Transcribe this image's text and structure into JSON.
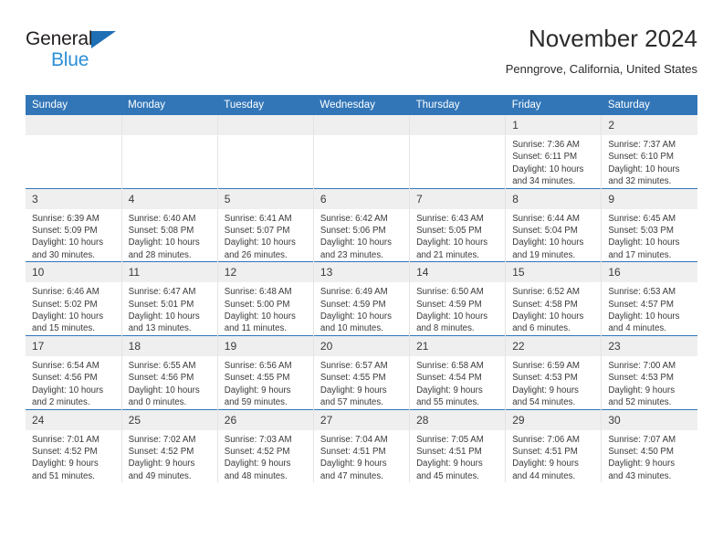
{
  "brand": {
    "name_part1": "General",
    "name_part2": "Blue",
    "triangle_color": "#1f6fb5",
    "blue_text_color": "#2b8fd6"
  },
  "header": {
    "title": "November 2024",
    "subtitle": "Penngrove, California, United States"
  },
  "theme": {
    "header_row_bg": "#3276b8",
    "daynum_bg": "#efefef",
    "row_divider": "#3276b8",
    "cell_divider": "#e4e4e4",
    "text": "#3a3a3a"
  },
  "columns": [
    "Sunday",
    "Monday",
    "Tuesday",
    "Wednesday",
    "Thursday",
    "Friday",
    "Saturday"
  ],
  "weeks": [
    [
      {
        "day": "",
        "empty": true
      },
      {
        "day": "",
        "empty": true
      },
      {
        "day": "",
        "empty": true
      },
      {
        "day": "",
        "empty": true
      },
      {
        "day": "",
        "empty": true
      },
      {
        "day": "1",
        "sunrise": "Sunrise: 7:36 AM",
        "sunset": "Sunset: 6:11 PM",
        "daylight1": "Daylight: 10 hours",
        "daylight2": "and 34 minutes."
      },
      {
        "day": "2",
        "sunrise": "Sunrise: 7:37 AM",
        "sunset": "Sunset: 6:10 PM",
        "daylight1": "Daylight: 10 hours",
        "daylight2": "and 32 minutes."
      }
    ],
    [
      {
        "day": "3",
        "sunrise": "Sunrise: 6:39 AM",
        "sunset": "Sunset: 5:09 PM",
        "daylight1": "Daylight: 10 hours",
        "daylight2": "and 30 minutes."
      },
      {
        "day": "4",
        "sunrise": "Sunrise: 6:40 AM",
        "sunset": "Sunset: 5:08 PM",
        "daylight1": "Daylight: 10 hours",
        "daylight2": "and 28 minutes."
      },
      {
        "day": "5",
        "sunrise": "Sunrise: 6:41 AM",
        "sunset": "Sunset: 5:07 PM",
        "daylight1": "Daylight: 10 hours",
        "daylight2": "and 26 minutes."
      },
      {
        "day": "6",
        "sunrise": "Sunrise: 6:42 AM",
        "sunset": "Sunset: 5:06 PM",
        "daylight1": "Daylight: 10 hours",
        "daylight2": "and 23 minutes."
      },
      {
        "day": "7",
        "sunrise": "Sunrise: 6:43 AM",
        "sunset": "Sunset: 5:05 PM",
        "daylight1": "Daylight: 10 hours",
        "daylight2": "and 21 minutes."
      },
      {
        "day": "8",
        "sunrise": "Sunrise: 6:44 AM",
        "sunset": "Sunset: 5:04 PM",
        "daylight1": "Daylight: 10 hours",
        "daylight2": "and 19 minutes."
      },
      {
        "day": "9",
        "sunrise": "Sunrise: 6:45 AM",
        "sunset": "Sunset: 5:03 PM",
        "daylight1": "Daylight: 10 hours",
        "daylight2": "and 17 minutes."
      }
    ],
    [
      {
        "day": "10",
        "sunrise": "Sunrise: 6:46 AM",
        "sunset": "Sunset: 5:02 PM",
        "daylight1": "Daylight: 10 hours",
        "daylight2": "and 15 minutes."
      },
      {
        "day": "11",
        "sunrise": "Sunrise: 6:47 AM",
        "sunset": "Sunset: 5:01 PM",
        "daylight1": "Daylight: 10 hours",
        "daylight2": "and 13 minutes."
      },
      {
        "day": "12",
        "sunrise": "Sunrise: 6:48 AM",
        "sunset": "Sunset: 5:00 PM",
        "daylight1": "Daylight: 10 hours",
        "daylight2": "and 11 minutes."
      },
      {
        "day": "13",
        "sunrise": "Sunrise: 6:49 AM",
        "sunset": "Sunset: 4:59 PM",
        "daylight1": "Daylight: 10 hours",
        "daylight2": "and 10 minutes."
      },
      {
        "day": "14",
        "sunrise": "Sunrise: 6:50 AM",
        "sunset": "Sunset: 4:59 PM",
        "daylight1": "Daylight: 10 hours",
        "daylight2": "and 8 minutes."
      },
      {
        "day": "15",
        "sunrise": "Sunrise: 6:52 AM",
        "sunset": "Sunset: 4:58 PM",
        "daylight1": "Daylight: 10 hours",
        "daylight2": "and 6 minutes."
      },
      {
        "day": "16",
        "sunrise": "Sunrise: 6:53 AM",
        "sunset": "Sunset: 4:57 PM",
        "daylight1": "Daylight: 10 hours",
        "daylight2": "and 4 minutes."
      }
    ],
    [
      {
        "day": "17",
        "sunrise": "Sunrise: 6:54 AM",
        "sunset": "Sunset: 4:56 PM",
        "daylight1": "Daylight: 10 hours",
        "daylight2": "and 2 minutes."
      },
      {
        "day": "18",
        "sunrise": "Sunrise: 6:55 AM",
        "sunset": "Sunset: 4:56 PM",
        "daylight1": "Daylight: 10 hours",
        "daylight2": "and 0 minutes."
      },
      {
        "day": "19",
        "sunrise": "Sunrise: 6:56 AM",
        "sunset": "Sunset: 4:55 PM",
        "daylight1": "Daylight: 9 hours",
        "daylight2": "and 59 minutes."
      },
      {
        "day": "20",
        "sunrise": "Sunrise: 6:57 AM",
        "sunset": "Sunset: 4:55 PM",
        "daylight1": "Daylight: 9 hours",
        "daylight2": "and 57 minutes."
      },
      {
        "day": "21",
        "sunrise": "Sunrise: 6:58 AM",
        "sunset": "Sunset: 4:54 PM",
        "daylight1": "Daylight: 9 hours",
        "daylight2": "and 55 minutes."
      },
      {
        "day": "22",
        "sunrise": "Sunrise: 6:59 AM",
        "sunset": "Sunset: 4:53 PM",
        "daylight1": "Daylight: 9 hours",
        "daylight2": "and 54 minutes."
      },
      {
        "day": "23",
        "sunrise": "Sunrise: 7:00 AM",
        "sunset": "Sunset: 4:53 PM",
        "daylight1": "Daylight: 9 hours",
        "daylight2": "and 52 minutes."
      }
    ],
    [
      {
        "day": "24",
        "sunrise": "Sunrise: 7:01 AM",
        "sunset": "Sunset: 4:52 PM",
        "daylight1": "Daylight: 9 hours",
        "daylight2": "and 51 minutes."
      },
      {
        "day": "25",
        "sunrise": "Sunrise: 7:02 AM",
        "sunset": "Sunset: 4:52 PM",
        "daylight1": "Daylight: 9 hours",
        "daylight2": "and 49 minutes."
      },
      {
        "day": "26",
        "sunrise": "Sunrise: 7:03 AM",
        "sunset": "Sunset: 4:52 PM",
        "daylight1": "Daylight: 9 hours",
        "daylight2": "and 48 minutes."
      },
      {
        "day": "27",
        "sunrise": "Sunrise: 7:04 AM",
        "sunset": "Sunset: 4:51 PM",
        "daylight1": "Daylight: 9 hours",
        "daylight2": "and 47 minutes."
      },
      {
        "day": "28",
        "sunrise": "Sunrise: 7:05 AM",
        "sunset": "Sunset: 4:51 PM",
        "daylight1": "Daylight: 9 hours",
        "daylight2": "and 45 minutes."
      },
      {
        "day": "29",
        "sunrise": "Sunrise: 7:06 AM",
        "sunset": "Sunset: 4:51 PM",
        "daylight1": "Daylight: 9 hours",
        "daylight2": "and 44 minutes."
      },
      {
        "day": "30",
        "sunrise": "Sunrise: 7:07 AM",
        "sunset": "Sunset: 4:50 PM",
        "daylight1": "Daylight: 9 hours",
        "daylight2": "and 43 minutes."
      }
    ]
  ]
}
